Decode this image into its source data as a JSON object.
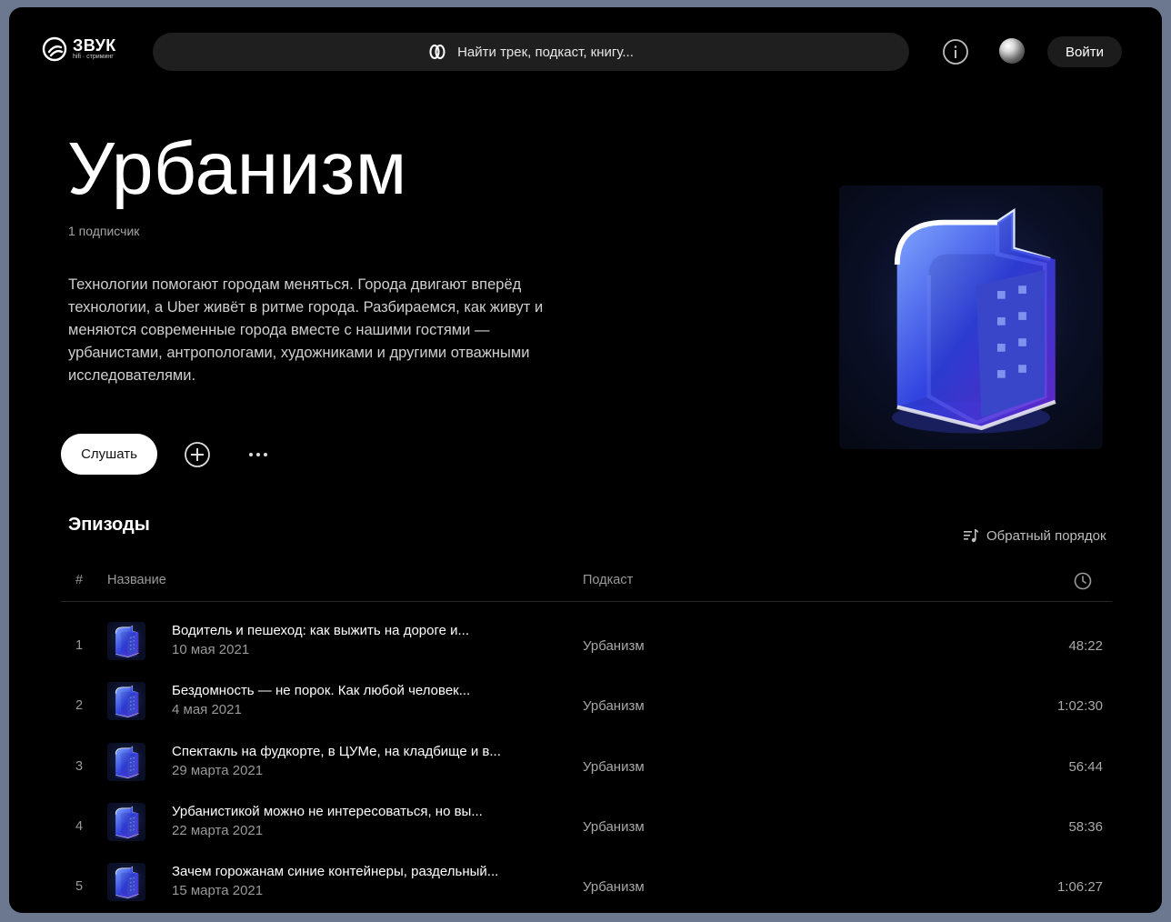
{
  "header": {
    "logo_title": "ЗВУК",
    "logo_subtitle": "hifi · стриминг",
    "search_placeholder": "Найти трек, подкаст, книгу...",
    "login_label": "Войти"
  },
  "podcast": {
    "title": "Урбанизм",
    "subscribers": "1 подписчик",
    "description": "Технологии помогают городам меняться. Города двигают вперёд технологии, а Uber живёт в ритме города. Разбираемся, как живут и меняются современные города вместе с нашими гостями — урбанистами, антропологами, художниками и другими отважными исследователями.",
    "listen_label": "Слушать"
  },
  "episodes": {
    "heading": "Эпизоды",
    "sort_label": "Обратный порядок",
    "columns": {
      "num": "#",
      "name": "Название",
      "podcast": "Подкаст"
    },
    "items": [
      {
        "num": "1",
        "title": "Водитель и пешеход: как выжить на дороге и...",
        "date": "10 мая 2021",
        "podcast": "Урбанизм",
        "duration": "48:22"
      },
      {
        "num": "2",
        "title": "Бездомность — не порок. Как любой человек...",
        "date": "4 мая 2021",
        "podcast": "Урбанизм",
        "duration": "1:02:30"
      },
      {
        "num": "3",
        "title": "Спектакль на фудкорте, в ЦУМе, на кладбище и в...",
        "date": "29 марта 2021",
        "podcast": "Урбанизм",
        "duration": "56:44"
      },
      {
        "num": "4",
        "title": "Урбанистикой можно не интересоваться, но вы...",
        "date": "22 марта 2021",
        "podcast": "Урбанизм",
        "duration": "58:36"
      },
      {
        "num": "5",
        "title": "Зачем горожанам синие контейнеры, раздельный...",
        "date": "15 марта 2021",
        "podcast": "Урбанизм",
        "duration": "1:06:27"
      }
    ]
  },
  "colors": {
    "background": "#000000",
    "accent_cover": "#3a4cff"
  }
}
